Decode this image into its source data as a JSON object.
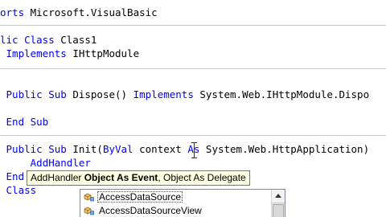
{
  "code_lines": {
    "l1": {
      "kw": "orts",
      "text": " Microsoft.VisualBasic"
    },
    "l2": {
      "kw": "lic Class",
      "text": " Class1"
    },
    "l3": {
      "kw": "Implements",
      "text": " IHttpModule"
    },
    "l4": {
      "kw1": "Public Sub",
      "text": " Dispose() ",
      "kw2": "Implements",
      "text2": " System.Web.IHttpModule.Dispo"
    },
    "l5": {
      "kw": "End Sub"
    },
    "l6": {
      "kw1": "Public Sub",
      "text": " Init(",
      "kw2": "ByVal",
      "text2": " context ",
      "kw3": "As",
      "text3": " System.Web.HttpApplication)"
    },
    "l7": {
      "kw": "AddHandler"
    },
    "l8": {
      "kw": "End"
    },
    "l9": {
      "kw": "Class"
    }
  },
  "tooltip": {
    "method": "AddHandler",
    "current_param": "Object As Event",
    "separator": ",",
    "next_param": " Object As Delegate"
  },
  "completion": {
    "items": [
      {
        "label": "AccessDataSource",
        "icon": "class-icon"
      },
      {
        "label": "AccessDataSourceView",
        "icon": "class-icon"
      }
    ]
  },
  "colors": {
    "keyword": "#0000ff",
    "tooltip_bg": "#ffffe1"
  }
}
